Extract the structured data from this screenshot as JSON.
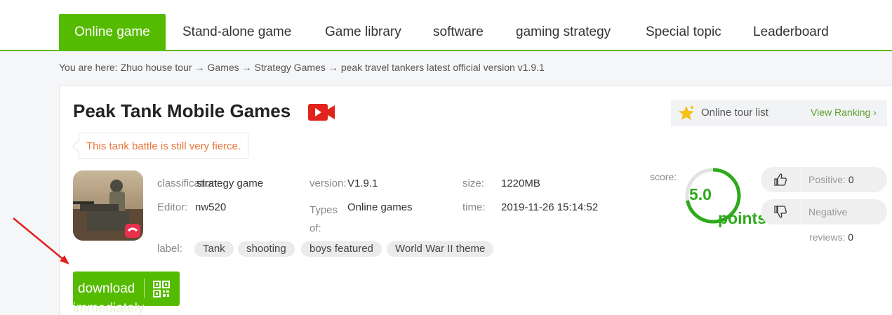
{
  "nav": {
    "items": [
      {
        "label": "Online game"
      },
      {
        "label": "Stand-alone game"
      },
      {
        "label": "Game library"
      },
      {
        "label": "software"
      },
      {
        "label": "gaming strategy"
      },
      {
        "label": "Special topic"
      },
      {
        "label": "Leaderboard"
      }
    ],
    "active_index": 0
  },
  "breadcrumb": {
    "prefix": "You are here:",
    "items": [
      "Zhuo house tour",
      "Games",
      "Strategy Games",
      "peak travel tankers latest official version v1.9.1"
    ],
    "separator": "→"
  },
  "game": {
    "title": "Peak Tank Mobile Games",
    "tagline": "This tank battle is still very fierce.",
    "classification_label": "classification:",
    "classification_value": "strategy game",
    "editor_label": "Editor:",
    "editor_value": "nw520",
    "version_label": "version:",
    "version_value": "V1.9.1",
    "types_label": "Types of:",
    "types_value": "Online games",
    "size_label": "size:",
    "size_value": "1220MB",
    "time_label": "time:",
    "time_value": "2019-11-26 15:14:52",
    "tags_label": "label:",
    "tags": [
      "Tank",
      "shooting",
      "boys featured",
      "World War II theme"
    ]
  },
  "download": {
    "label": "download",
    "sub_label": "immediately"
  },
  "ranking": {
    "title": "Online tour list",
    "link": "View Ranking",
    "link_arrow": "›"
  },
  "score": {
    "label": "score:",
    "value": "5.0",
    "unit": "points",
    "fraction": 1.0
  },
  "votes": {
    "positive_label": "Positive:",
    "positive_count": "0",
    "negative_label": "Negative",
    "negative_label2": "reviews:",
    "negative_count": "0"
  },
  "colors": {
    "brand_green": "#55bb00",
    "score_green": "#2daa1a",
    "tagline_orange": "#e8743b",
    "video_red": "#e0241b",
    "annotation_arrow": "#e02020"
  }
}
